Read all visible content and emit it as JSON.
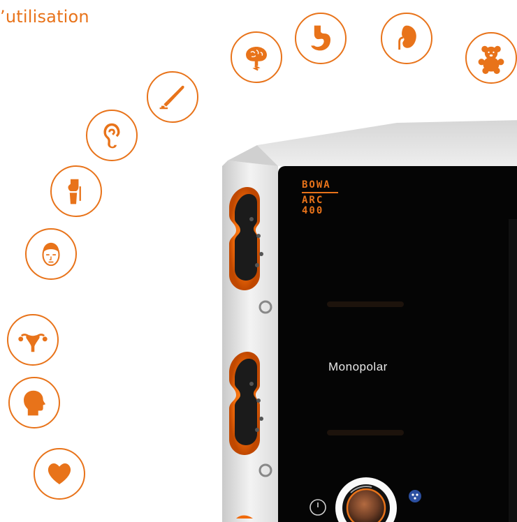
{
  "heading": {
    "text": "’utilisation"
  },
  "device": {
    "logo_brand": "BOWA",
    "logo_model_row1": "ARC",
    "logo_model_row2": "400",
    "mode_label": "Monopolar"
  },
  "colors": {
    "accent": "#e8731a",
    "screen": "#050505"
  },
  "icons": [
    "heart-icon",
    "head-profile-icon",
    "uterus-icon",
    "face-icon",
    "knee-joint-icon",
    "ear-icon",
    "scalpel-icon",
    "brain-icon",
    "stomach-icon",
    "kidney-icon",
    "teddy-bear-icon"
  ]
}
